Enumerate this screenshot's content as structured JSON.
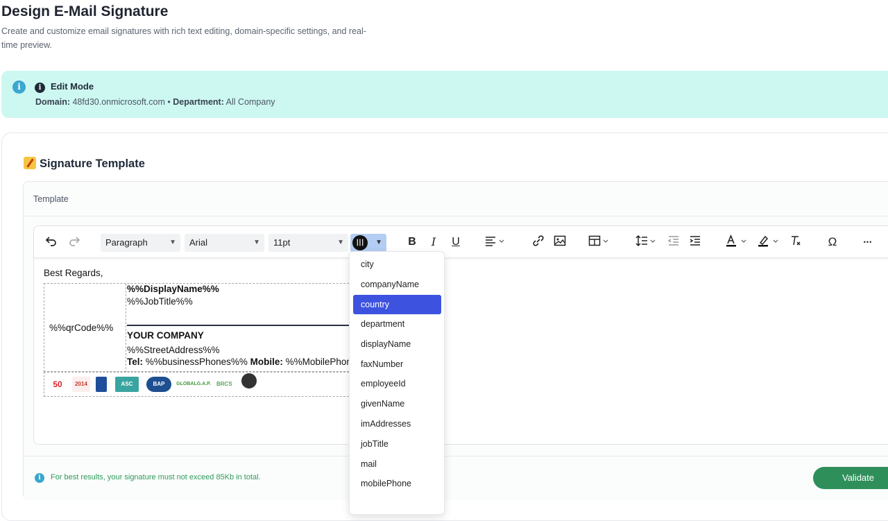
{
  "header": {
    "title": "Design E-Mail Signature",
    "description": "Create and customize email signatures with rich text editing, domain-specific settings, and real-time preview."
  },
  "banner": {
    "mode": "Edit Mode",
    "domain_label": "Domain:",
    "domain_value": "48fd30.onmicrosoft.com",
    "separator": "•",
    "department_label": "Department:",
    "department_value": "All Company"
  },
  "card": {
    "title": "Signature Template",
    "template_label": "Template"
  },
  "toolbar": {
    "block_format": "Paragraph",
    "font_family": "Arial",
    "font_size": "11pt",
    "bold": "B",
    "italic": "I",
    "underline": "U",
    "special_char": "Ω",
    "more": "•••"
  },
  "editor": {
    "greeting": "Best Regards,",
    "qr_code": "%%qrCode%%",
    "display_name": "%%DisplayName%%",
    "job_title": "%%JobTitle%%",
    "company": "YOUR COMPANY",
    "street_address": "%%StreetAddress%%",
    "tel_label": "Tel:",
    "tel_value": "%%businessPhones%%",
    "mobile_label": "Mobile:",
    "mobile_value": "%%MobilePhone%%"
  },
  "logos": [
    {
      "label": "50",
      "color": "#d9272e"
    },
    {
      "label": "2014",
      "color": "#c0392b"
    },
    {
      "label": "",
      "color": "#1f4e9b"
    },
    {
      "label": "ASC",
      "color": "#3aa5a0"
    },
    {
      "label": "BAP",
      "color": "#1d4f91"
    },
    {
      "label": "GLOBALG.A.P.",
      "color": "#3e9a3a"
    },
    {
      "label": "BRCS",
      "color": "#5aa65a"
    },
    {
      "label": "",
      "color": "#333333"
    }
  ],
  "dropdown": {
    "items": [
      "city",
      "companyName",
      "country",
      "department",
      "displayName",
      "faxNumber",
      "employeeId",
      "givenName",
      "imAddresses",
      "jobTitle",
      "mail",
      "mobilePhone"
    ],
    "selected": "country"
  },
  "footer": {
    "note": "For best results, your signature must not exceed 85Kb in total.",
    "validate_label": "Validate"
  },
  "colors": {
    "banner_bg": "#cdf8f1",
    "selected_item": "#3d53e0",
    "validate_button": "#2f8f5b",
    "note_text": "#2e9a5c"
  }
}
